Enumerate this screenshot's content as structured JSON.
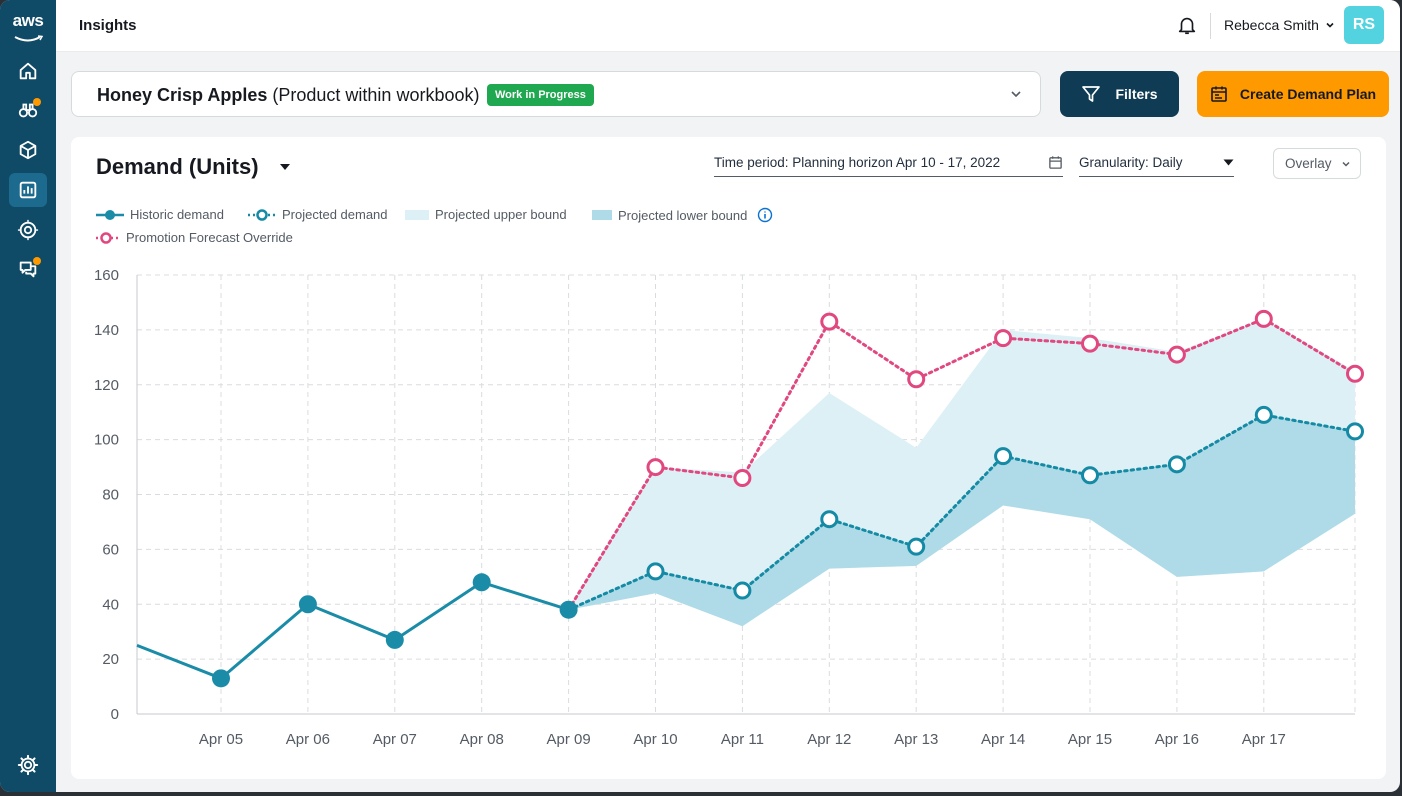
{
  "app": {
    "logo_text": "aws",
    "page_title": "Insights"
  },
  "sidebar": {
    "items": [
      {
        "icon": "home-icon"
      },
      {
        "icon": "binoculars-icon",
        "notification": true
      },
      {
        "icon": "box-icon"
      },
      {
        "icon": "bar-chart-icon",
        "active": true
      },
      {
        "icon": "target-icon"
      },
      {
        "icon": "chat-icon",
        "notification": true
      }
    ],
    "footer_icon": "gear-icon"
  },
  "header": {
    "user_name": "Rebecca Smith",
    "avatar_initials": "RS",
    "bell_icon": "bell-icon"
  },
  "product": {
    "name": "Honey Crisp Apples",
    "context": "(Product within workbook)",
    "status": "Work in Progress",
    "status_color": "#1fa84f"
  },
  "actions": {
    "filters_label": "Filters",
    "create_label": "Create Demand Plan"
  },
  "chart_panel": {
    "title": "Demand (Units)",
    "time_period": "Time period: Planning horizon Apr 10 - 17, 2022",
    "granularity": "Granularity: Daily",
    "view_mode": "Overlay"
  },
  "legend": {
    "historic": "Historic demand",
    "projected": "Projected demand",
    "upper": "Projected upper bound",
    "lower": "Projected lower bound",
    "promo": "Promotion Forecast Override"
  },
  "colors": {
    "historic": "#1a8ca8",
    "projected": "#148aa5",
    "promo": "#e0487f",
    "upper_fill": "#ddf0f5",
    "lower_fill": "#aedbe7",
    "accent_orange": "#ff9900",
    "nav_bg": "#0f4a66"
  },
  "chart_data": {
    "type": "line",
    "categories": [
      "Apr 05",
      "Apr 06",
      "Apr 07",
      "Apr 08",
      "Apr 09",
      "Apr 10",
      "Apr 11",
      "Apr 12",
      "Apr 13",
      "Apr 14",
      "Apr 15",
      "Apr 16",
      "Apr 17"
    ],
    "ylim": [
      0,
      160
    ],
    "yticks": [
      0,
      20,
      40,
      60,
      80,
      100,
      120,
      140,
      160
    ],
    "grid": true,
    "legend_position": "top-left",
    "series": [
      {
        "name": "Historic demand",
        "x": [
          "Apr 05",
          "Apr 06",
          "Apr 07",
          "Apr 08",
          "Apr 09"
        ],
        "values": [
          13,
          40,
          27,
          48,
          38
        ],
        "leading_value": 25
      },
      {
        "name": "Projected demand",
        "x": [
          "Apr 09",
          "Apr 10",
          "Apr 11",
          "Apr 12",
          "Apr 13",
          "Apr 14",
          "Apr 15",
          "Apr 16",
          "Apr 17"
        ],
        "values": [
          38,
          52,
          45,
          71,
          61,
          94,
          87,
          91,
          109
        ],
        "trailing_value": 103
      },
      {
        "name": "Promotion Forecast Override",
        "x": [
          "Apr 09",
          "Apr 10",
          "Apr 11",
          "Apr 12",
          "Apr 13",
          "Apr 14",
          "Apr 15",
          "Apr 16",
          "Apr 17"
        ],
        "values": [
          38,
          90,
          86,
          143,
          122,
          137,
          135,
          131,
          144
        ],
        "trailing_value": 124
      },
      {
        "name": "Projected upper bound",
        "x": [
          "Apr 09",
          "Apr 10",
          "Apr 11",
          "Apr 12",
          "Apr 13",
          "Apr 14",
          "Apr 15",
          "Apr 16",
          "Apr 17"
        ],
        "values": [
          38,
          90,
          88,
          117,
          97,
          140,
          137,
          132,
          144
        ],
        "trailing_value": 125
      },
      {
        "name": "Projected lower bound",
        "x": [
          "Apr 09",
          "Apr 10",
          "Apr 11",
          "Apr 12",
          "Apr 13",
          "Apr 14",
          "Apr 15",
          "Apr 16",
          "Apr 17"
        ],
        "values": [
          38,
          44,
          32,
          53,
          54,
          76,
          71,
          50,
          52
        ],
        "trailing_value": 73
      }
    ]
  }
}
